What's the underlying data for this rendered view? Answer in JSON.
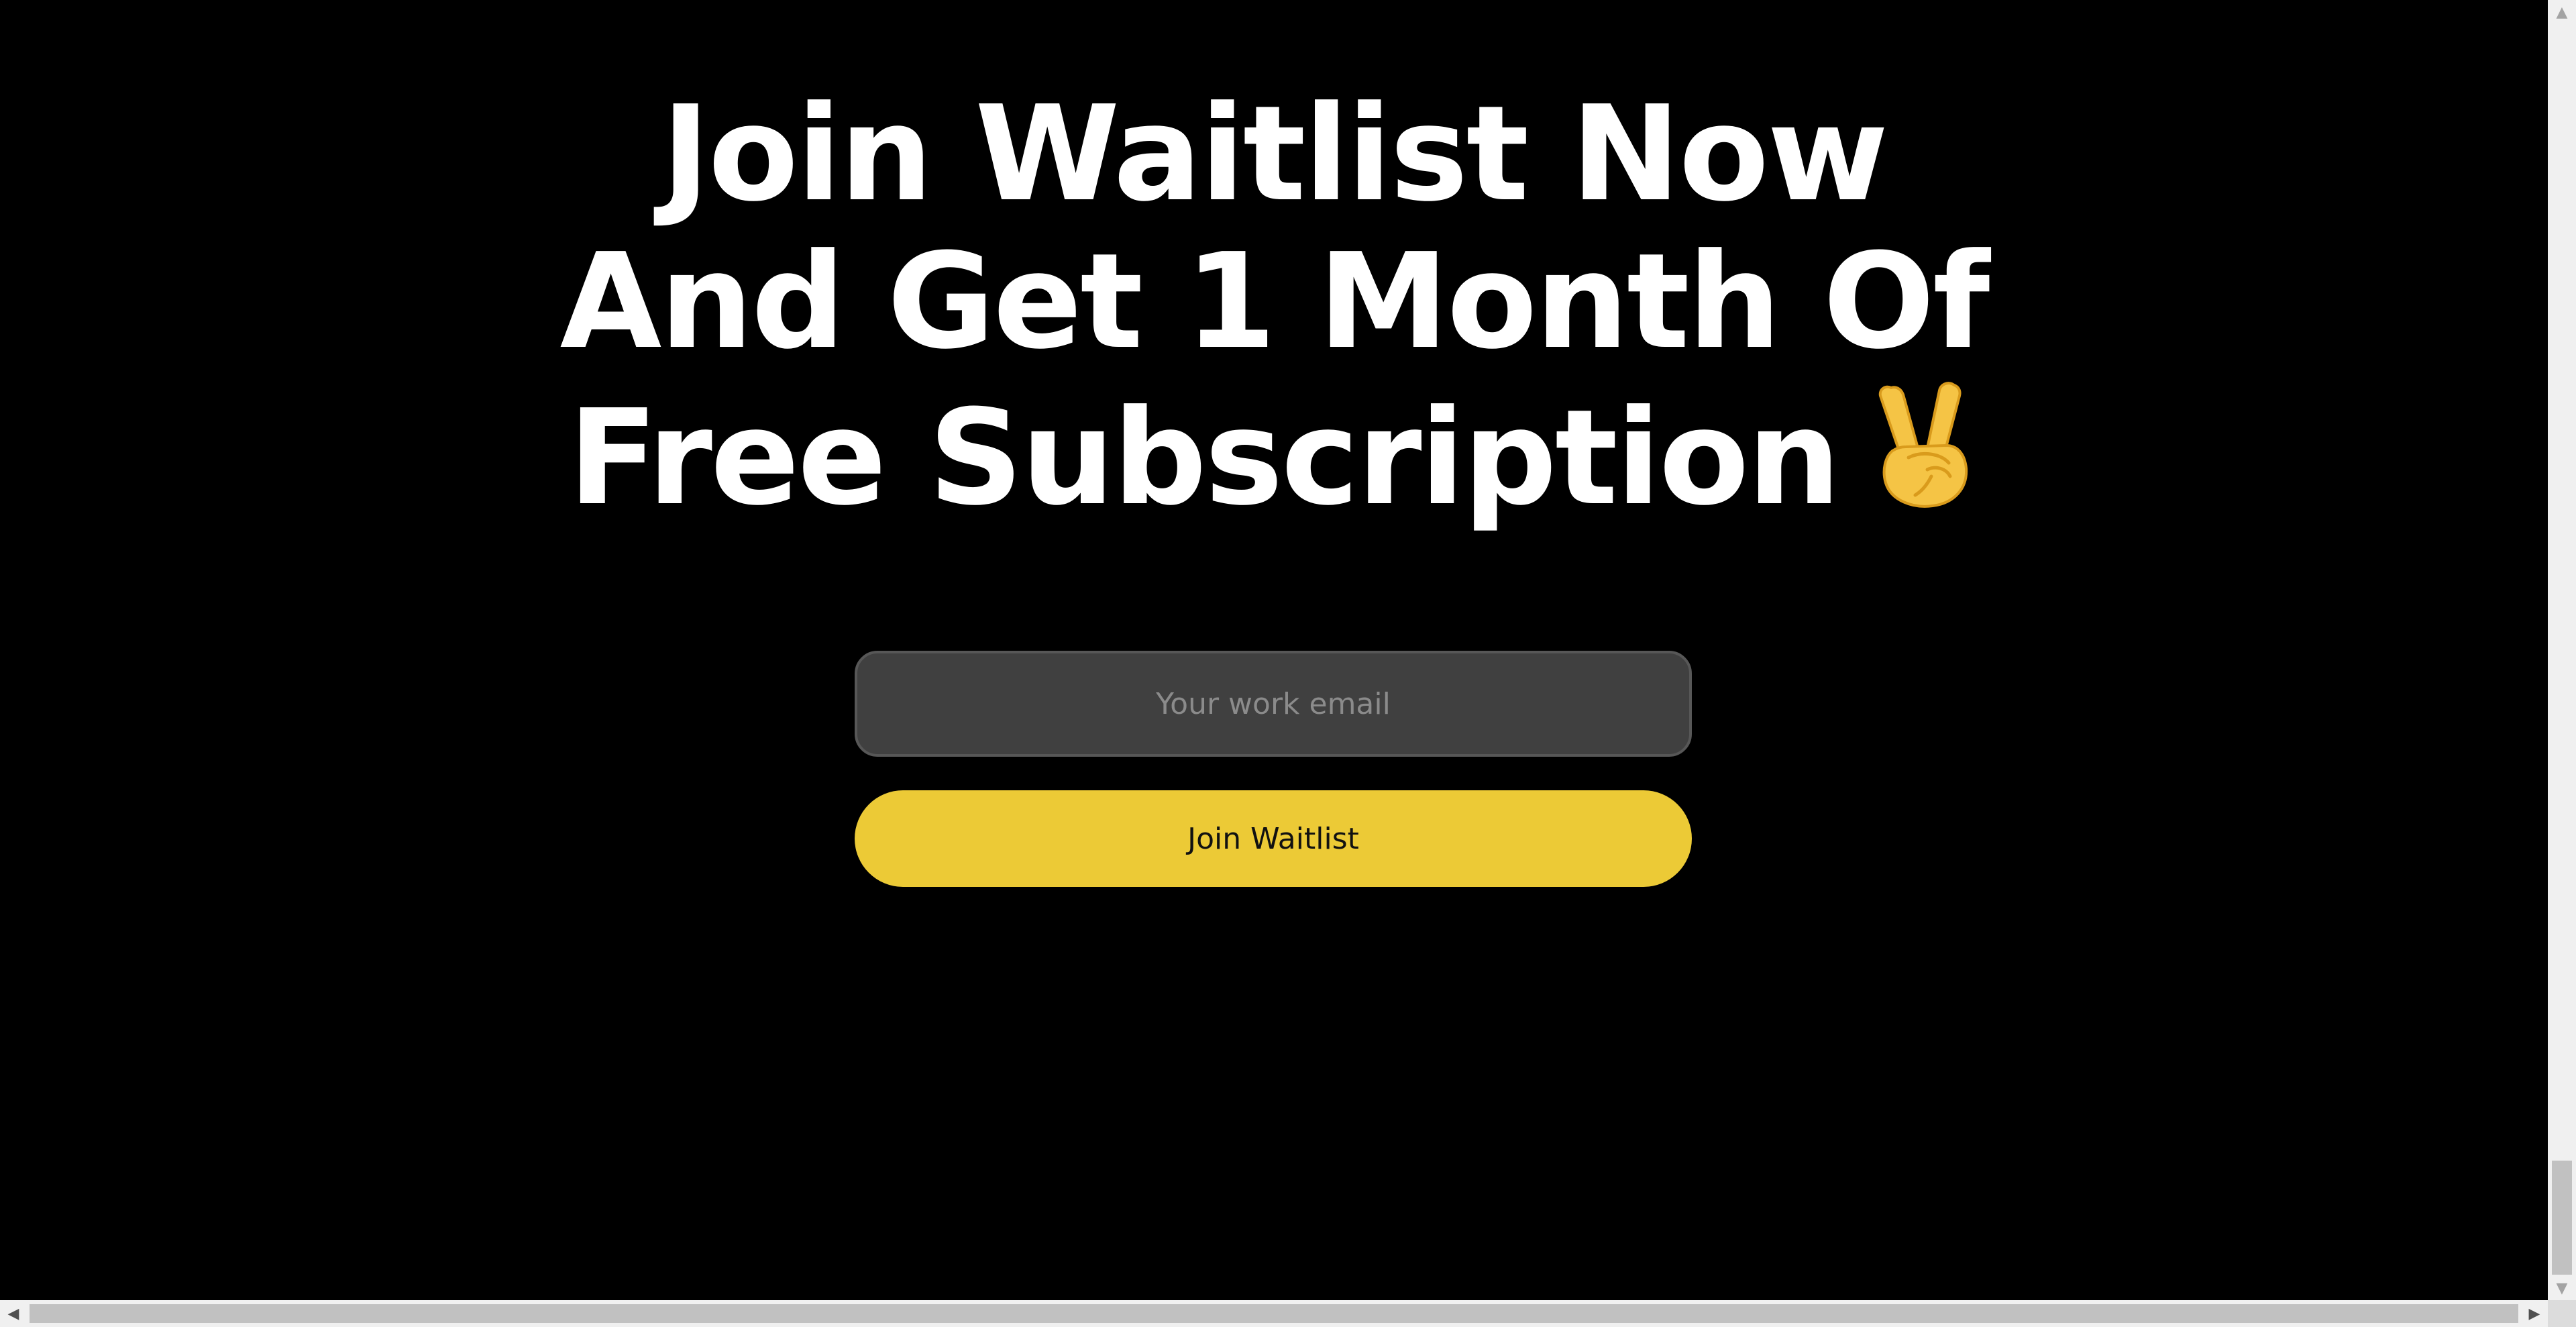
{
  "headline": {
    "line1": "Join Waitlist Now",
    "line2": "And Get 1 Month Of",
    "line3": "Free Subscription",
    "emoji_icon": "victory-hand-icon"
  },
  "form": {
    "email_placeholder": "Your work email",
    "email_value": "",
    "submit_label": "Join Waitlist"
  },
  "colors": {
    "background": "#000000",
    "headline_text": "#ffffff",
    "input_background": "#404040",
    "input_border": "#575757",
    "placeholder": "#8b8b8b",
    "button_background": "#ecca36",
    "button_text": "#111111"
  },
  "scrollbars": {
    "vertical_icons": [
      "scroll-up-icon",
      "scroll-down-icon"
    ],
    "horizontal_icons": [
      "scroll-left-icon",
      "scroll-right-icon"
    ]
  }
}
